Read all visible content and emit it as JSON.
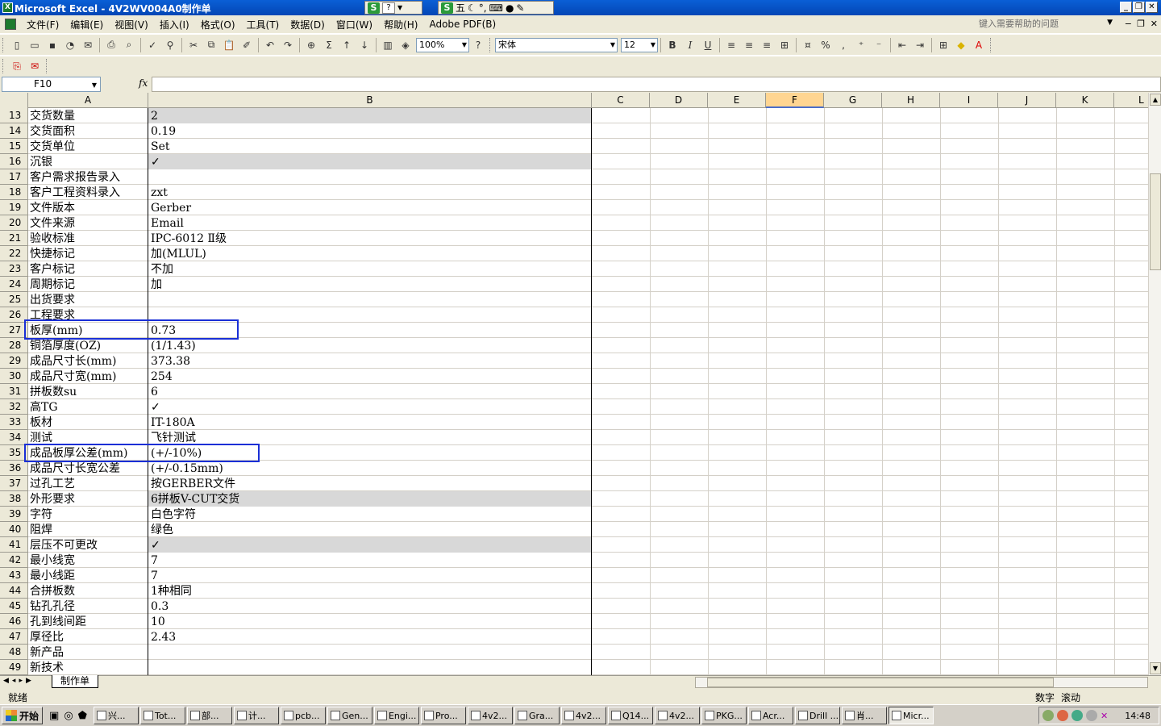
{
  "window": {
    "title": "Microsoft Excel - 4V2WV004A0制作单"
  },
  "title_tray": {
    "label": "五",
    "icons": [
      "moon-icon",
      "dot-icon",
      "keyboard-icon",
      "person-icon",
      "wrench-icon"
    ]
  },
  "menu": {
    "items": [
      "文件(F)",
      "编辑(E)",
      "视图(V)",
      "插入(I)",
      "格式(O)",
      "工具(T)",
      "数据(D)",
      "窗口(W)",
      "帮助(H)",
      "Adobe PDF(B)"
    ],
    "help_placeholder": "键入需要帮助的问题"
  },
  "toolbar": {
    "zoom": "100%",
    "font": "宋体",
    "font_size": "12",
    "bold": "B",
    "italic": "I",
    "underline": "U",
    "percent": "%",
    "comma": ","
  },
  "formula_bar": {
    "name_box": "F10",
    "fx": "fx",
    "formula": ""
  },
  "columns": [
    "A",
    "B",
    "C",
    "D",
    "E",
    "F",
    "G",
    "H",
    "I",
    "J",
    "K",
    "L"
  ],
  "selected_column": "F",
  "rows": [
    {
      "n": "13",
      "a": "交货数量",
      "b": "2",
      "shade": true
    },
    {
      "n": "14",
      "a": "交货面积",
      "b": "0.19",
      "shade": false
    },
    {
      "n": "15",
      "a": "交货单位",
      "b": "Set",
      "shade": false
    },
    {
      "n": "16",
      "a": "沉银",
      "b": "✓",
      "shade": true
    },
    {
      "n": "17",
      "a": "客户需求报告录入",
      "b": "",
      "shade": false
    },
    {
      "n": "18",
      "a": "客户工程资料录入",
      "b": "zxt",
      "shade": false
    },
    {
      "n": "19",
      "a": "文件版本",
      "b": "Gerber",
      "shade": false
    },
    {
      "n": "20",
      "a": "文件来源",
      "b": "Email",
      "shade": false
    },
    {
      "n": "21",
      "a": "验收标准",
      "b": "IPC-6012 Ⅱ级",
      "shade": false
    },
    {
      "n": "22",
      "a": "快捷标记",
      "b": "加(MLUL)",
      "shade": false
    },
    {
      "n": "23",
      "a": "客户标记",
      "b": "不加",
      "shade": false
    },
    {
      "n": "24",
      "a": "周期标记",
      "b": "加",
      "shade": false
    },
    {
      "n": "25",
      "a": "出货要求",
      "b": "",
      "shade": false
    },
    {
      "n": "26",
      "a": "工程要求",
      "b": "",
      "shade": false
    },
    {
      "n": "27",
      "a": "板厚(mm)",
      "b": "0.73",
      "shade": false
    },
    {
      "n": "28",
      "a": "铜箔厚度(OZ)",
      "b": "(1/1.43)",
      "shade": false
    },
    {
      "n": "29",
      "a": "成品尺寸长(mm)",
      "b": "373.38",
      "shade": false
    },
    {
      "n": "30",
      "a": "成品尺寸宽(mm)",
      "b": "254",
      "shade": false
    },
    {
      "n": "31",
      "a": "拼板数su",
      "b": "6",
      "shade": false
    },
    {
      "n": "32",
      "a": "高TG",
      "b": "✓",
      "shade": false
    },
    {
      "n": "33",
      "a": "板材",
      "b": "IT-180A",
      "shade": false
    },
    {
      "n": "34",
      "a": "测试",
      "b": "飞针测试",
      "shade": false
    },
    {
      "n": "35",
      "a": "成品板厚公差(mm)",
      "b": "(+/-10%)",
      "shade": false
    },
    {
      "n": "36",
      "a": "成品尺寸长宽公差",
      "b": "(+/-0.15mm)",
      "shade": false
    },
    {
      "n": "37",
      "a": "过孔工艺",
      "b": "按GERBER文件",
      "shade": false
    },
    {
      "n": "38",
      "a": "外形要求",
      "b": "6拼板V-CUT交货",
      "shade": true
    },
    {
      "n": "39",
      "a": "字符",
      "b": "白色字符",
      "shade": false
    },
    {
      "n": "40",
      "a": "阻焊",
      "b": "绿色",
      "shade": false
    },
    {
      "n": "41",
      "a": "层压不可更改",
      "b": "✓",
      "shade": true
    },
    {
      "n": "42",
      "a": "最小线宽",
      "b": "7",
      "shade": false
    },
    {
      "n": "43",
      "a": "最小线距",
      "b": "7",
      "shade": false
    },
    {
      "n": "44",
      "a": "合拼板数",
      "b": "1种相同",
      "shade": false
    },
    {
      "n": "45",
      "a": "钻孔孔径",
      "b": "0.3",
      "shade": false
    },
    {
      "n": "46",
      "a": "孔到线间距",
      "b": "10",
      "shade": false
    },
    {
      "n": "47",
      "a": "厚径比",
      "b": "2.43",
      "shade": false
    },
    {
      "n": "48",
      "a": "新产品",
      "b": "",
      "shade": false
    },
    {
      "n": "49",
      "a": "新技术",
      "b": "",
      "shade": false
    }
  ],
  "sheet_tab": "制作单",
  "status": {
    "left": "就绪",
    "num": "数字",
    "scroll": "滚动"
  },
  "taskbar": {
    "start": "开始",
    "tasks": [
      "兴...",
      "Tot...",
      "部...",
      "计...",
      "pcb...",
      "Gen...",
      "Engi...",
      "Pro...",
      "4v2...",
      "Gra...",
      "4v2...",
      "Q14...",
      "4v2...",
      "PKG...",
      "Acr...",
      "Drill ...",
      "肖...",
      "Micr..."
    ],
    "clock": "14:48"
  },
  "colors": {
    "title_bar": "#0a5fd6",
    "highlight_box": "#1a2fd6",
    "shaded_cell": "#d8d8d8",
    "chrome": "#ece9d8"
  }
}
